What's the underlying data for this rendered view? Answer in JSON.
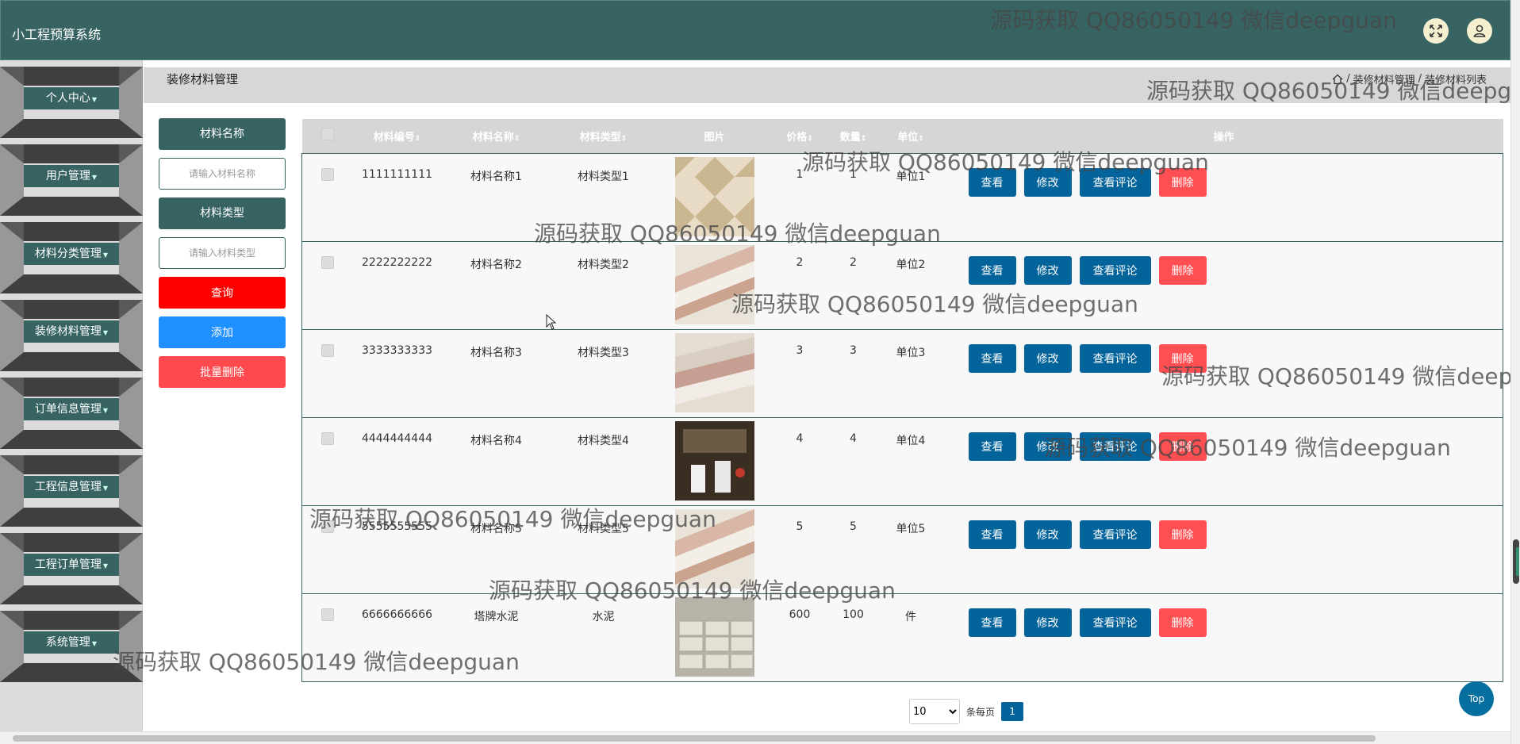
{
  "header": {
    "app_title": "小工程预算系统"
  },
  "sidebar": {
    "items": [
      {
        "label": "个人中心"
      },
      {
        "label": "用户管理"
      },
      {
        "label": "材料分类管理"
      },
      {
        "label": "装修材料管理"
      },
      {
        "label": "订单信息管理"
      },
      {
        "label": "工程信息管理"
      },
      {
        "label": "工程订单管理"
      },
      {
        "label": "系统管理"
      }
    ]
  },
  "page": {
    "heading": "装修材料管理",
    "breadcrumb": {
      "sep": "/",
      "level1": "装修材料管理",
      "level2": "装修材料列表"
    }
  },
  "filter": {
    "name_label": "材料名称",
    "name_placeholder": "请输入材料名称",
    "type_label": "材料类型",
    "type_placeholder": "请输入材料类型",
    "search_label": "查询",
    "add_label": "添加",
    "bulk_delete_label": "批量删除"
  },
  "table": {
    "columns": {
      "code": "材料编号",
      "name": "材料名称",
      "type": "材料类型",
      "image": "图片",
      "price": "价格",
      "qty": "数量",
      "unit": "单位",
      "ops": "操作"
    },
    "sort_glyph": "⇕",
    "actions": {
      "view": "查看",
      "edit": "修改",
      "review": "查看评论",
      "delete": "删除"
    },
    "rows": [
      {
        "code": "1111111111",
        "name": "材料名称1",
        "type": "材料类型1",
        "price": "1",
        "qty": "1",
        "unit": "单位1"
      },
      {
        "code": "2222222222",
        "name": "材料名称2",
        "type": "材料类型2",
        "price": "2",
        "qty": "2",
        "unit": "单位2"
      },
      {
        "code": "3333333333",
        "name": "材料名称3",
        "type": "材料类型3",
        "price": "3",
        "qty": "3",
        "unit": "单位3"
      },
      {
        "code": "4444444444",
        "name": "材料名称4",
        "type": "材料类型4",
        "price": "4",
        "qty": "4",
        "unit": "单位4"
      },
      {
        "code": "5555555555",
        "name": "材料名称5",
        "type": "材料类型5",
        "price": "5",
        "qty": "5",
        "unit": "单位5"
      },
      {
        "code": "6666666666",
        "name": "塔牌水泥",
        "type": "水泥",
        "price": "600",
        "qty": "100",
        "unit": "件"
      }
    ]
  },
  "pager": {
    "page_size": "10",
    "per_page_label": "条每页",
    "current_page": "1"
  },
  "top_button": "Top",
  "watermark": "源码获取 QQ86050149 微信deepguan",
  "colors": {
    "header": "#376462",
    "primary": "#03639b",
    "danger": "#ff4f52",
    "search": "#ff0000",
    "add": "#1e90ff"
  }
}
